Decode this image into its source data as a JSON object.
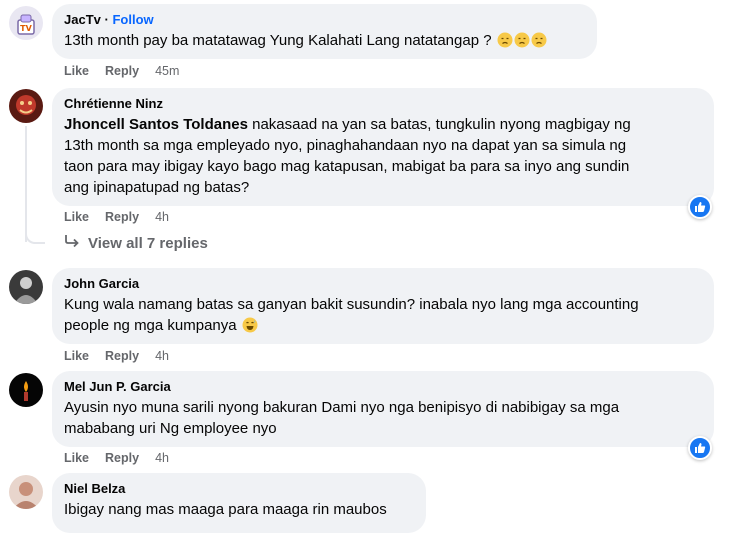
{
  "comments": [
    {
      "author": "JacTv",
      "dot": "·",
      "follow": "Follow",
      "text": "13th month pay ba matatawag Yung Kalahati Lang natatangap ?",
      "like": "Like",
      "reply": "Reply",
      "time": "45m"
    },
    {
      "author": "Chrétienne Ninz",
      "mention": "Jhoncell Santos Toldanes",
      "text_line1": " nakasaad na yan sa batas, tungkulin nyong magbigay ng",
      "text_line2": "13th month sa mga empleyado nyo, pinaghahandaan nyo na dapat yan sa simula ng",
      "text_line3": "taon para may ibigay kayo bago mag katapusan, mabigat ba para sa inyo ang sundin",
      "text_line4": "ang ipinapatupad ng batas?",
      "like": "Like",
      "reply": "Reply",
      "time": "4h"
    },
    {
      "author": "John Garcia",
      "text_line1": "Kung wala namang batas sa ganyan bakit susundin? inabala nyo lang mga accounting",
      "text_line2": "people ng mga kumpanya",
      "like": "Like",
      "reply": "Reply",
      "time": "4h"
    },
    {
      "author": "Mel Jun P. Garcia",
      "text_line1": "Ayusin nyo muna sarili nyong bakuran Dami nyo nga benipisyo di nabibigay sa mga",
      "text_line2": "mababang uri Ng employee nyo",
      "like": "Like",
      "reply": "Reply",
      "time": "4h"
    },
    {
      "author": "Niel Belza",
      "text": "Ibigay nang mas maaga para maaga rin maubos"
    }
  ],
  "view_replies": "View all 7 replies",
  "colors": {
    "bubble": "#f0f2f5",
    "meta": "#65676b",
    "link": "#0866ff",
    "reaction": "#1877f2"
  },
  "icons": {
    "reply_arrow": "reply-arrow-icon",
    "reaction": "like-reaction-icon",
    "emoji_sad": "sad-face-emoji",
    "emoji_laugh": "grinning-sweat-emoji"
  }
}
